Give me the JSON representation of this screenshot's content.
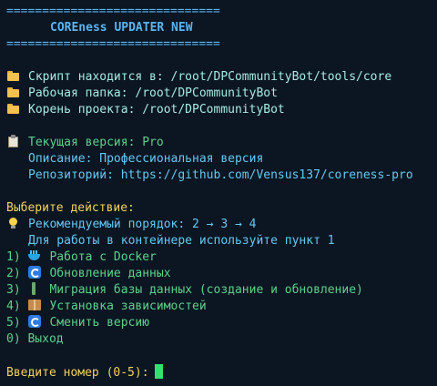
{
  "colors": {
    "background": "#0b1622",
    "separator": "#5ab4f0",
    "info_text": "#a7ebe1",
    "version_text": "#5fd08b",
    "prompt_text": "#f2d060",
    "menu_text": "#5fd08b",
    "hint_text": "#66c7f0",
    "cursor": "#33e06f"
  },
  "header": {
    "separator_top": "==============================",
    "title": "COREness UPDATER NEW",
    "separator_bottom": "=============================="
  },
  "paths": {
    "script": "Скрипт находится в: /root/DPCommunityBot/tools/core",
    "workdir": "Рабочая папка: /root/DPCommunityBot",
    "project_root": "Корень проекта: /root/DPCommunityBot",
    "icon": "folder-icon"
  },
  "version": {
    "current": "Текущая версия: Pro",
    "description": "Описание: Профессиональная версия",
    "repository": "Репозиторий: https://github.com/Vensus137/coreness-pro",
    "icon": "clipboard-icon"
  },
  "menu": {
    "prompt": "Выберите действие:",
    "recommended": "Рекомендуемый порядок: 2 → 3 → 4",
    "container_hint": "Для работы в контейнере используйте пункт 1",
    "items": [
      {
        "number": "1)",
        "label": "Работа с Docker",
        "icon": "docker-whale-icon"
      },
      {
        "number": "2)",
        "label": "Обновление данных",
        "icon": "sync-icon"
      },
      {
        "number": "3)",
        "label": "Миграция базы данных (создание и обновление)",
        "icon": "database-icon"
      },
      {
        "number": "4)",
        "label": "Установка зависимостей",
        "icon": "package-icon"
      },
      {
        "number": "5)",
        "label": "Сменить версию",
        "icon": "sync-icon"
      },
      {
        "number": "0)",
        "label": "Выход",
        "icon": ""
      }
    ]
  },
  "input": {
    "prompt": "Введите номер (0-5):",
    "value": ""
  }
}
